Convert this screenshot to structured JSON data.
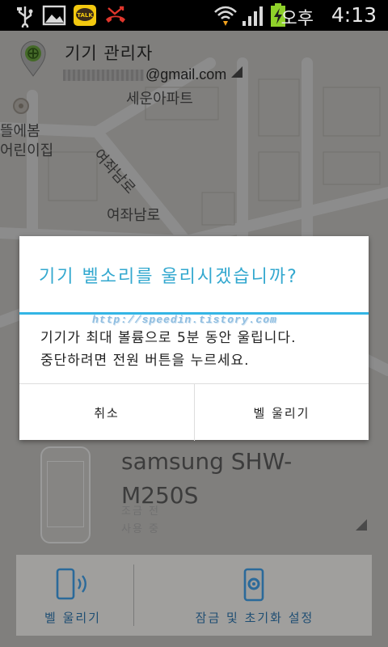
{
  "status_bar": {
    "ampm": "오후",
    "time": "4:13",
    "icons": [
      "usb-icon",
      "image-icon",
      "kakaotalk-icon",
      "missed-call-icon",
      "wifi-icon",
      "signal-icon",
      "battery-charging-icon"
    ],
    "kakao_label": "TALK"
  },
  "header": {
    "title": "기기 관리자",
    "account": "@gmail.com"
  },
  "map": {
    "labels": [
      "세운아파트",
      "뜰에봄",
      "어린이집",
      "여좌남로",
      "여좌남로"
    ]
  },
  "dialog": {
    "title": "기기 벨소리를 울리시겠습니까?",
    "message_line1": "기기가 최대 볼륨으로 5분 동안 울립니다.",
    "message_line2": "중단하려면 전원 버튼을 누르세요.",
    "cancel_label": "취소",
    "confirm_label": "벨 울리기",
    "watermark": "http://speedin.tistory.com"
  },
  "device": {
    "name": "samsung SHW-M250S",
    "status_line1": "조금 전",
    "status_line2": "사용 중"
  },
  "actions": {
    "ring_label": "벨 울리기",
    "lock_label": "잠금 및 초기화 설정"
  },
  "colors": {
    "accent": "#33b5e5",
    "title_blue": "#33a8cf",
    "action_blue": "#1f4e73"
  }
}
